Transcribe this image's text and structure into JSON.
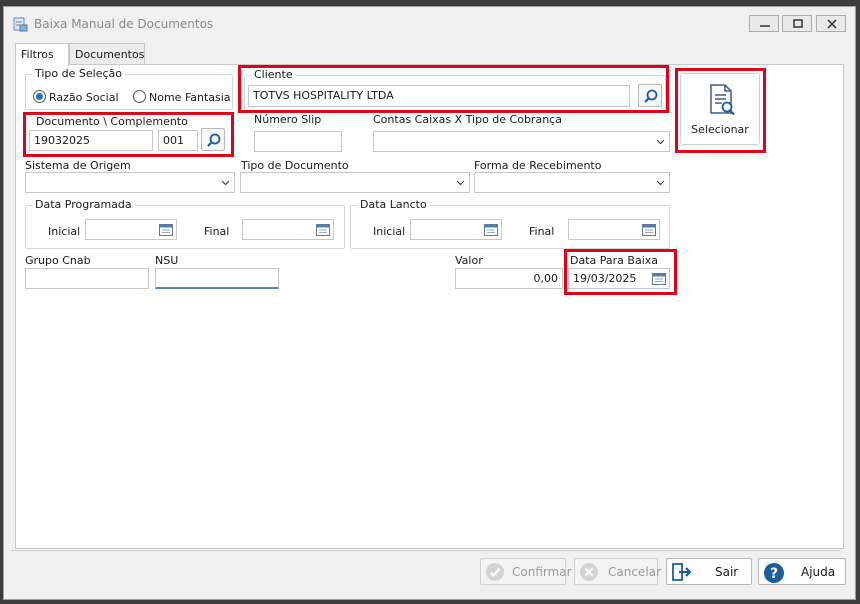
{
  "window": {
    "title": "Baixa Manual de Documentos"
  },
  "tabs": [
    {
      "label": "Filtros"
    },
    {
      "label": "Documentos"
    }
  ],
  "selection_type": {
    "title": "Tipo de Seleção",
    "options": [
      {
        "label": "Razão Social",
        "checked": true
      },
      {
        "label": "Nome Fantasia",
        "checked": false
      }
    ]
  },
  "client": {
    "label": "Cliente",
    "value": "TOTVS HOSPITALITY LTDA"
  },
  "document": {
    "label": "Documento \\ Complemento",
    "number": "19032025",
    "complement": "001"
  },
  "slip": {
    "label": "Número Slip",
    "value": ""
  },
  "accounts": {
    "label": "Contas Caixas X Tipo de Cobrança",
    "value": ""
  },
  "select_button": {
    "label": "Selecionar"
  },
  "origin_system": {
    "label": "Sistema de Origem",
    "value": ""
  },
  "document_type": {
    "label": "Tipo de Documento",
    "value": ""
  },
  "payment_method": {
    "label": "Forma de Recebimento",
    "value": ""
  },
  "scheduled_date": {
    "title": "Data Programada",
    "start_label": "Inicial",
    "end_label": "Final",
    "start": "",
    "end": ""
  },
  "entry_date": {
    "title": "Data Lancto",
    "start_label": "Inicial",
    "end_label": "Final",
    "start": "",
    "end": ""
  },
  "cnab_group": {
    "label": "Grupo Cnab",
    "value": ""
  },
  "nsu": {
    "label": "NSU",
    "value": ""
  },
  "amount": {
    "label": "Valor",
    "value": "0,00"
  },
  "settlement_date": {
    "label": "Data Para Baixa",
    "value": "19/03/2025"
  },
  "actions": {
    "confirm": {
      "label": "Confirmar",
      "enabled": false
    },
    "cancel": {
      "label": "Cancelar",
      "enabled": false
    },
    "exit": {
      "label": "Sair",
      "enabled": true
    },
    "help": {
      "label": "Ajuda",
      "enabled": true
    }
  },
  "colors": {
    "highlight": "#e0001a",
    "accent": "#1a73c8"
  }
}
